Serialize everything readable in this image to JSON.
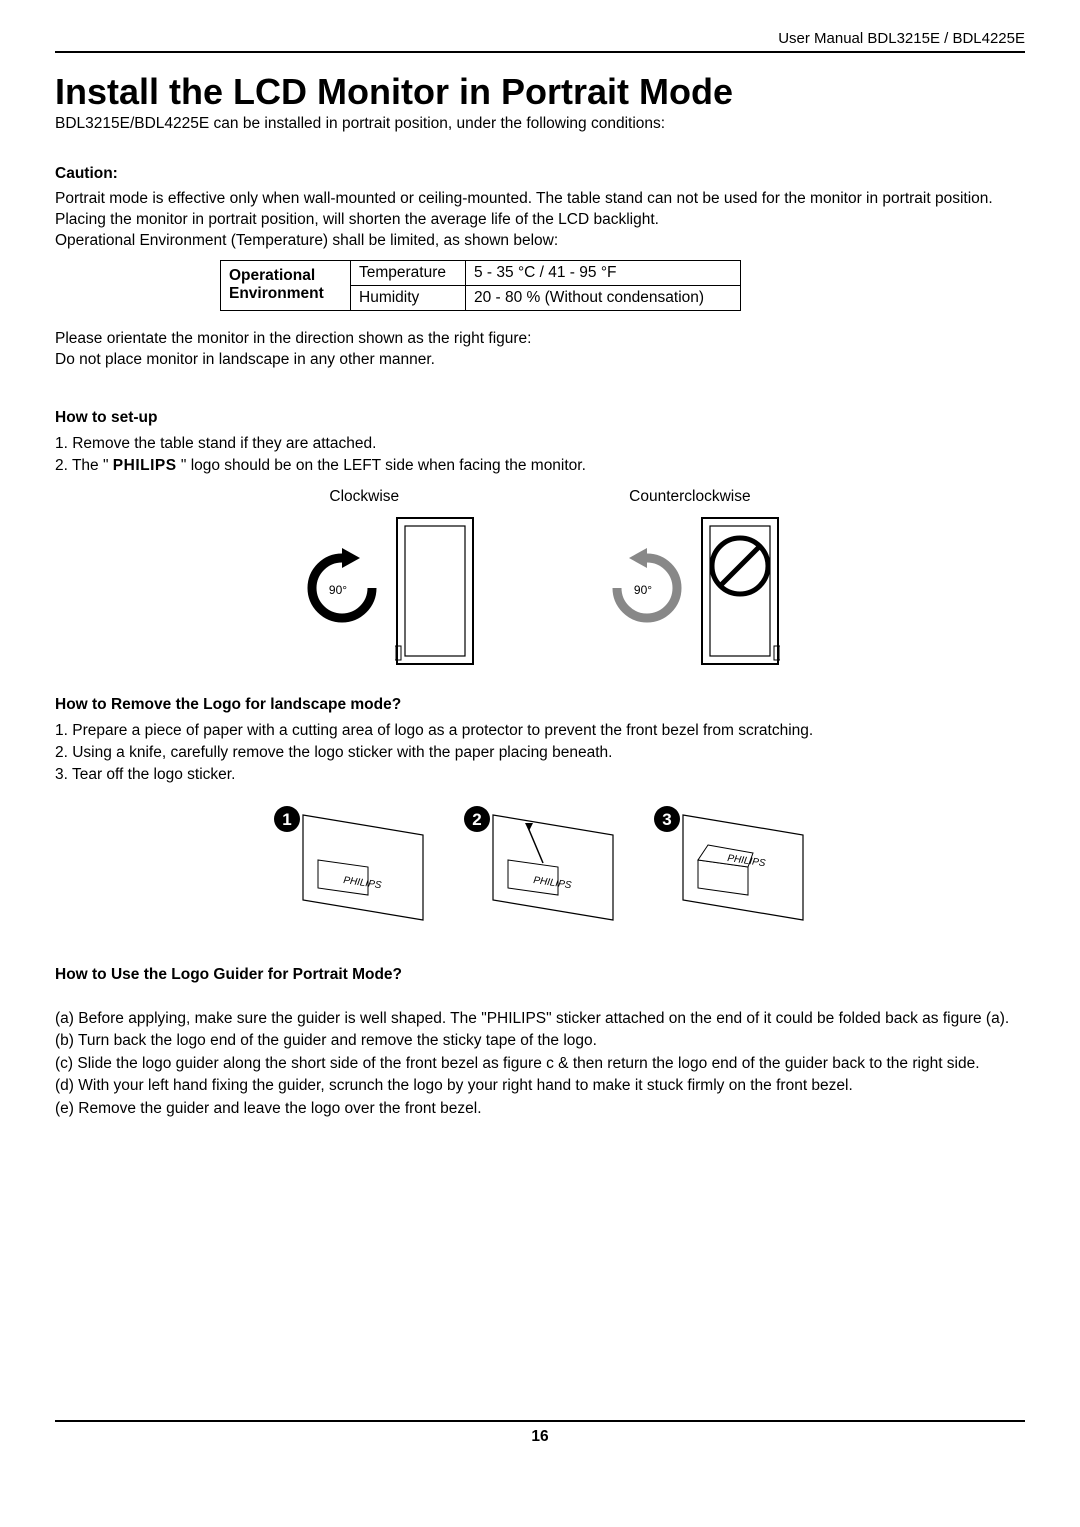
{
  "header": {
    "manual": "User Manual BDL3215E / BDL4225E"
  },
  "title": "Install the LCD Monitor in Portrait Mode",
  "subtitle": "BDL3215E/BDL4225E can be installed in portrait position, under the following conditions:",
  "caution": {
    "heading": "Caution:",
    "p1": "Portrait mode is effective only when wall-mounted or ceiling-mounted. The table stand can not be used for the monitor in portrait position.",
    "p2": "Placing the monitor in portrait position, will shorten the average life of the LCD backlight.",
    "p3": "Operational Environment (Temperature) shall be limited, as shown below:"
  },
  "env_table": {
    "row_head": "Operational Environment",
    "r1c1": "Temperature",
    "r1c2": "5 - 35 °C / 41 - 95 °F",
    "r2c1": "Humidity",
    "r2c2": "20 - 80 % (Without condensation)"
  },
  "post_table": {
    "l1": "Please orientate the monitor in the direction shown as the right figure:",
    "l2": "Do not place monitor in landscape in any other manner."
  },
  "setup": {
    "heading": "How to set-up",
    "s1": "1.  Remove the table stand if they are attached.",
    "s2_pre": "2. The \" ",
    "s2_logo": "PHILIPS",
    "s2_post": " \" logo should be on the LEFT side when facing the monitor."
  },
  "diagram": {
    "cw_label": "Clockwise",
    "ccw_label": "Counterclockwise",
    "angle": "90°"
  },
  "remove_logo": {
    "heading": "How to Remove the Logo for landscape mode?",
    "l1": "1. Prepare a piece of paper with a cutting area of logo as a protector to prevent the front bezel from scratching.",
    "l2": "2. Using a knife, carefully remove the logo sticker with the paper placing beneath.",
    "l3": "3. Tear off the logo sticker."
  },
  "fig_labels": {
    "n1": "1",
    "n2": "2",
    "n3": "3"
  },
  "logo_guider": {
    "heading": "How to Use the Logo Guider for Portrait Mode?",
    "a": "(a) Before applying, make sure the guider is well shaped. The \"PHILIPS\" sticker attached on the end of it could be folded back as figure (a).",
    "b": "(b) Turn back the logo end of the guider and remove the sticky tape of the logo.",
    "c": "(c) Slide the logo guider along the short side of the front bezel as figure c & then return the logo end of the guider back to the right side.",
    "d": "(d) With your left hand fixing the guider, scrunch the logo by your right hand to make it stuck firmly on the front bezel.",
    "e": "(e) Remove the guider and leave the logo over the front bezel."
  },
  "footer": {
    "page": "16"
  }
}
